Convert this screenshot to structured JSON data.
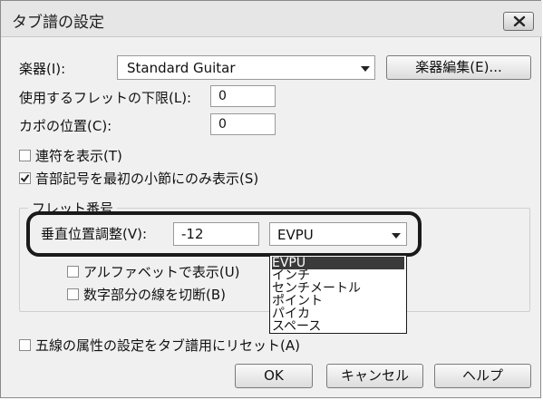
{
  "window": {
    "title": "タブ譜の設定"
  },
  "instrument": {
    "label": "楽器(I):",
    "value": "Standard Guitar",
    "edit_button": "楽器編集(E)..."
  },
  "fret_lower_limit": {
    "label": "使用するフレットの下限(L):",
    "value": "0"
  },
  "capo": {
    "label": "カポの位置(C):",
    "value": "0"
  },
  "checkboxes": {
    "show_tuplets": {
      "label": "連符を表示(T)",
      "checked": false
    },
    "show_clef_first_measure": {
      "label": "音部記号を最初の小節にのみ表示(S)",
      "checked": true
    }
  },
  "fret_numbers_group": {
    "title": "フレット番号",
    "vertical_adjust": {
      "label": "垂直位置調整(V):",
      "value": "-12",
      "unit": "EVPU"
    },
    "show_as_letters": {
      "label": "アルファベットで表示(U)",
      "checked": false
    },
    "break_lines": {
      "label": "数字部分の線を切断(B)",
      "checked": false
    }
  },
  "unit_dropdown": {
    "options": [
      "EVPU",
      "インチ",
      "センチメートル",
      "ポイント",
      "パイカ",
      "スペース"
    ],
    "selected": "EVPU"
  },
  "staff_attributes": {
    "label": "五線の属性の設定をタブ譜用にリセット(A)",
    "checked": false
  },
  "buttons": {
    "ok": "OK",
    "cancel": "キャンセル",
    "help": "ヘルプ"
  }
}
